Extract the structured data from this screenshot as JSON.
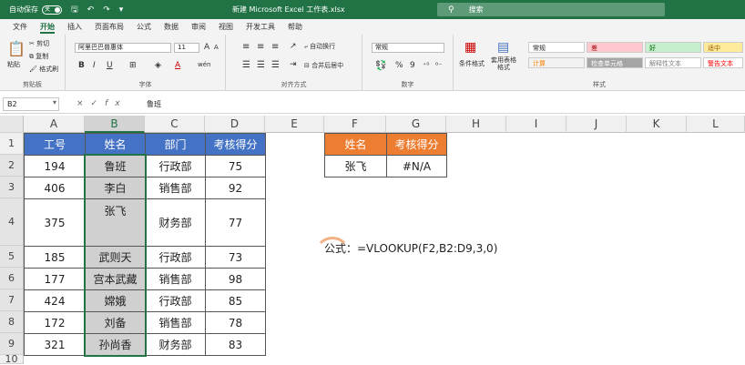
{
  "titlebar": {
    "autosave_label": "自动保存",
    "autosave_state": "关",
    "title": "新建 Microsoft Excel 工作表.xlsx",
    "search_placeholder": "搜索",
    "accent_color": "#217346"
  },
  "tabs": [
    "文件",
    "开始",
    "插入",
    "页面布局",
    "公式",
    "数据",
    "审阅",
    "视图",
    "开发工具",
    "帮助"
  ],
  "active_tab": "开始",
  "ribbon": {
    "clipboard": {
      "label": "剪贴板",
      "paste": "粘贴",
      "cut": "剪切",
      "copy": "复制",
      "format_painter": "格式刷"
    },
    "font": {
      "label": "字体",
      "font_name": "阿里巴巴普惠体",
      "font_size": "11",
      "bold": "B",
      "italic": "I",
      "underline": "U",
      "grow": "A",
      "shrink": "A",
      "font_color": "A",
      "wen": "wén"
    },
    "alignment": {
      "label": "对齐方式",
      "wrap": "自动换行",
      "merge": "合并后居中"
    },
    "number": {
      "label": "数字",
      "format": "常规",
      "percent": "%",
      "comma": "9"
    },
    "styles": {
      "label": "样式",
      "conditional": "条件格式",
      "table_format": "套用表格格式",
      "cells": [
        {
          "text": "常规",
          "bg": "#ffffff",
          "fg": "#222222"
        },
        {
          "text": "差",
          "bg": "#ffc7ce",
          "fg": "#9c0006"
        },
        {
          "text": "好",
          "bg": "#c6efce",
          "fg": "#006100"
        },
        {
          "text": "适中",
          "bg": "#ffeb9c",
          "fg": "#9c5700"
        },
        {
          "text": "计算",
          "bg": "#f2f2f2",
          "fg": "#fa7d00"
        },
        {
          "text": "检查单元格",
          "bg": "#a5a5a5",
          "fg": "#ffffff"
        },
        {
          "text": "解释性文本",
          "bg": "#ffffff",
          "fg": "#7f7f7f"
        },
        {
          "text": "警告文本",
          "bg": "#ffffff",
          "fg": "#ff0000"
        }
      ]
    }
  },
  "formula_bar": {
    "name_box": "B2",
    "cancel_icon": "×",
    "enter_icon": "✓",
    "fx_icon": "fx",
    "value": "鲁班"
  },
  "columns": [
    "A",
    "B",
    "C",
    "D",
    "E",
    "F",
    "G",
    "H",
    "I",
    "J",
    "K",
    "L"
  ],
  "rows": [
    "1",
    "2",
    "3",
    "4",
    "5",
    "6",
    "7",
    "8",
    "9",
    "10"
  ],
  "table": {
    "headers": [
      "工号",
      "姓名",
      "部门",
      "考核得分"
    ],
    "rows": [
      [
        "194",
        "鲁班",
        "行政部",
        "75"
      ],
      [
        "406",
        "李白",
        "销售部",
        "92"
      ],
      [
        "375",
        "张飞",
        "财务部",
        "77"
      ],
      [
        "185",
        "武则天",
        "行政部",
        "73"
      ],
      [
        "177",
        "宫本武藏",
        "销售部",
        "98"
      ],
      [
        "424",
        "嫦娥",
        "行政部",
        "85"
      ],
      [
        "172",
        "刘备",
        "销售部",
        "78"
      ],
      [
        "321",
        "孙尚香",
        "财务部",
        "83"
      ]
    ]
  },
  "lookup": {
    "headers": [
      "姓名",
      "考核得分"
    ],
    "values": [
      "张飞",
      "#N/A"
    ]
  },
  "formula_note": "公式：=VLOOKUP(F2,B2:D9,3,0)"
}
